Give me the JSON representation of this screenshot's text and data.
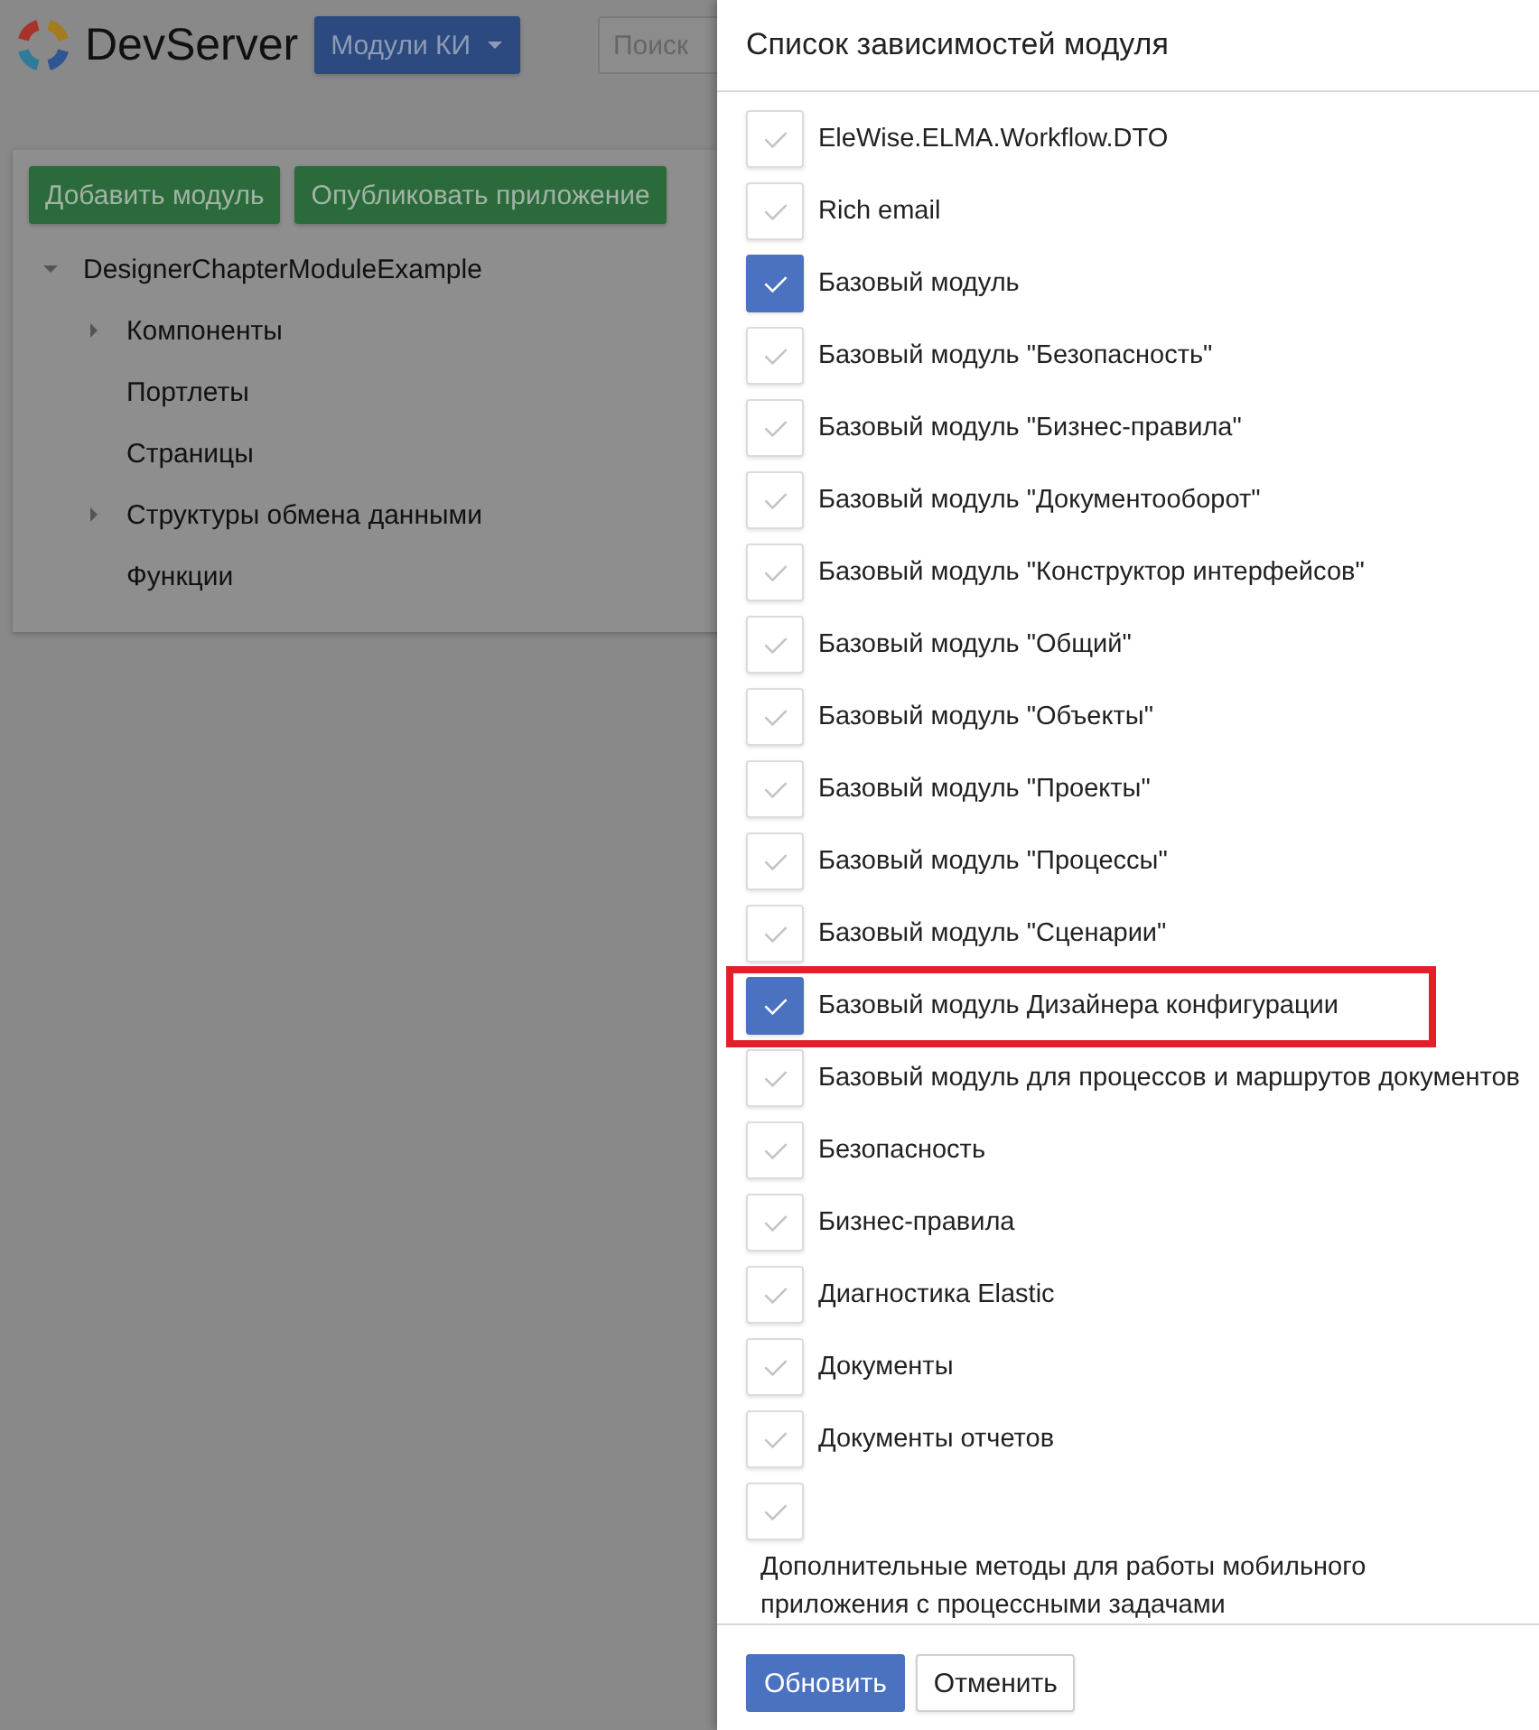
{
  "header": {
    "logo_text": "DevServer",
    "modules_menu": {
      "label": "Модули КИ"
    },
    "search": {
      "placeholder": "Поиск"
    }
  },
  "toolbar": {
    "buttons": [
      "Добавить модуль",
      "Опубликовать приложение"
    ]
  },
  "tree": [
    {
      "label": "DesignerChapterModuleExample",
      "kind": "branch",
      "expanded": true,
      "children": [
        {
          "label": "Компоненты",
          "kind": "branch",
          "expanded": false
        },
        {
          "label": "Портлеты",
          "kind": "leaf"
        },
        {
          "label": "Страницы",
          "kind": "leaf"
        },
        {
          "label": "Структуры обмена данными",
          "kind": "branch",
          "expanded": false
        },
        {
          "label": "Функции",
          "kind": "leaf"
        }
      ]
    }
  ],
  "modal": {
    "title": "Список зависимостей модуля",
    "items": [
      {
        "label": "EleWise.ELMA.Workflow.DTO",
        "checked": false,
        "highlighted": false
      },
      {
        "label": "Rich email",
        "checked": false,
        "highlighted": false
      },
      {
        "label": "Базовый модуль",
        "checked": true,
        "highlighted": false
      },
      {
        "label": "Базовый модуль \"Безопасность\"",
        "checked": false,
        "highlighted": false
      },
      {
        "label": "Базовый модуль \"Бизнес-правила\"",
        "checked": false,
        "highlighted": false
      },
      {
        "label": "Базовый модуль \"Документооборот\"",
        "checked": false,
        "highlighted": false
      },
      {
        "label": "Базовый модуль \"Конструктор интерфейсов\"",
        "checked": false,
        "highlighted": false
      },
      {
        "label": "Базовый модуль \"Общий\"",
        "checked": false,
        "highlighted": false
      },
      {
        "label": "Базовый модуль \"Объекты\"",
        "checked": false,
        "highlighted": false
      },
      {
        "label": "Базовый модуль \"Проекты\"",
        "checked": false,
        "highlighted": false
      },
      {
        "label": "Базовый модуль \"Процессы\"",
        "checked": false,
        "highlighted": false
      },
      {
        "label": "Базовый модуль \"Сценарии\"",
        "checked": false,
        "highlighted": false
      },
      {
        "label": "Базовый модуль Дизайнера конфигурации",
        "checked": true,
        "highlighted": true
      },
      {
        "label": "Базовый модуль для процессов и маршрутов документов",
        "checked": false,
        "highlighted": false
      },
      {
        "label": "Безопасность",
        "checked": false,
        "highlighted": false
      },
      {
        "label": "Бизнес-правила",
        "checked": false,
        "highlighted": false
      },
      {
        "label": "Диагностика Elastic",
        "checked": false,
        "highlighted": false
      },
      {
        "label": "Документы",
        "checked": false,
        "highlighted": false
      },
      {
        "label": "Документы отчетов",
        "checked": false,
        "highlighted": false
      },
      {
        "label": "Дополнительные методы для работы мобильного приложения с процессными задачами",
        "checked": false,
        "highlighted": false
      }
    ],
    "buttons": [
      {
        "label": "Обновить",
        "kind": "primary"
      },
      {
        "label": "Отменить",
        "kind": "default"
      }
    ]
  }
}
